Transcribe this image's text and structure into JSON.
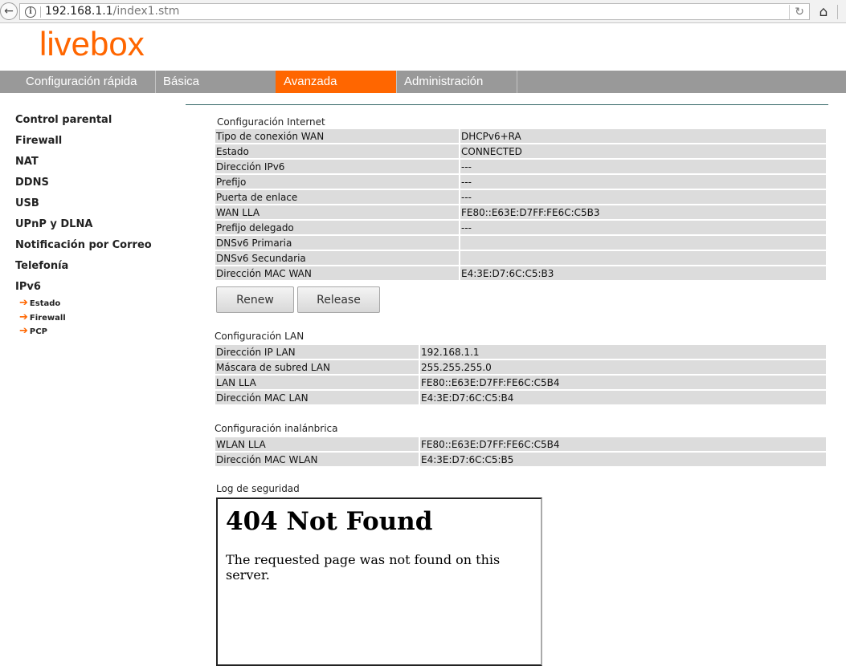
{
  "browser": {
    "url_host": "192.168.1.1",
    "url_path": "/index1.stm"
  },
  "logo": "livebox",
  "nav": [
    {
      "label": "Configuración rápida",
      "active": false
    },
    {
      "label": "Básica",
      "active": false
    },
    {
      "label": "Avanzada",
      "active": true
    },
    {
      "label": "Administración",
      "active": false
    }
  ],
  "sidebar": {
    "items": [
      "Control parental",
      "Firewall",
      "NAT",
      "DDNS",
      "USB",
      "UPnP y DLNA",
      "Notificación por Correo",
      "Telefonía",
      "IPv6"
    ],
    "subitems": [
      "Estado",
      "Firewall",
      "PCP"
    ]
  },
  "internet": {
    "title": "Configuración Internet",
    "rows": [
      {
        "label": "Tipo de conexión WAN",
        "value": "DHCPv6+RA"
      },
      {
        "label": "Estado",
        "value": "CONNECTED"
      },
      {
        "label": "Dirección IPv6",
        "value": "---"
      },
      {
        "label": "Prefijo",
        "value": "---"
      },
      {
        "label": "Puerta de enlace",
        "value": "---"
      },
      {
        "label": "WAN LLA",
        "value": "FE80::E63E:D7FF:FE6C:C5B3"
      },
      {
        "label": "Prefijo delegado",
        "value": "---"
      },
      {
        "label": "DNSv6 Primaria",
        "value": ""
      },
      {
        "label": "DNSv6 Secundaria",
        "value": ""
      },
      {
        "label": "Dirección MAC WAN",
        "value": "E4:3E:D7:6C:C5:B3"
      }
    ],
    "renew_label": "Renew",
    "release_label": "Release"
  },
  "lan": {
    "title": "Configuración LAN",
    "rows": [
      {
        "label": "Dirección IP LAN",
        "value": "192.168.1.1"
      },
      {
        "label": "Máscara de subred LAN",
        "value": "255.255.255.0"
      },
      {
        "label": "LAN LLA",
        "value": "FE80::E63E:D7FF:FE6C:C5B4"
      },
      {
        "label": "Dirección MAC LAN",
        "value": "E4:3E:D7:6C:C5:B4"
      }
    ]
  },
  "wireless": {
    "title": "Configuración inalánbrica",
    "rows": [
      {
        "label": "WLAN LLA",
        "value": "FE80::E63E:D7FF:FE6C:C5B4"
      },
      {
        "label": "Dirección MAC WLAN",
        "value": "E4:3E:D7:6C:C5:B5"
      }
    ]
  },
  "security_log": {
    "title": "Log de seguridad",
    "heading": "404 Not Found",
    "message": "The requested page was not found on this server."
  },
  "colors": {
    "brand": "#ff6600",
    "nav_bg": "#999999",
    "row_bg": "#dcdcdc"
  }
}
